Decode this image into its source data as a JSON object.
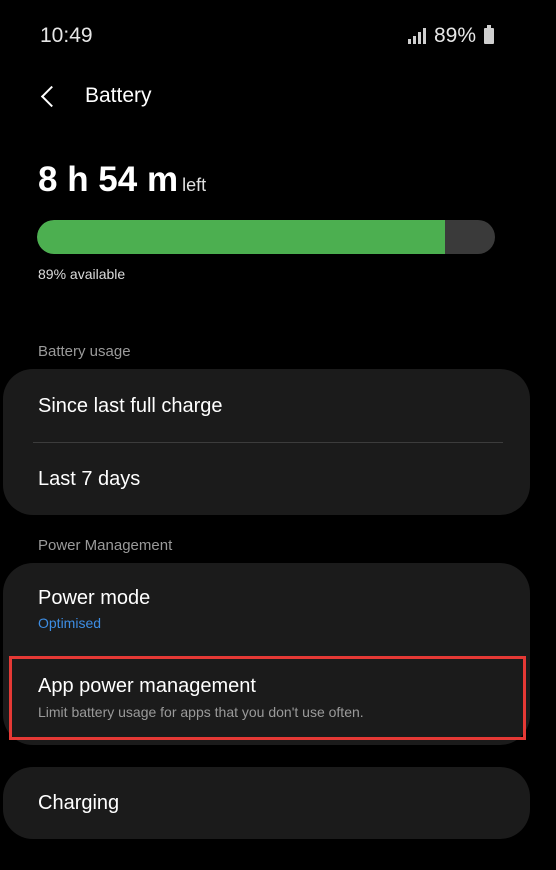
{
  "status_bar": {
    "time": "10:49",
    "battery_percent": "89%",
    "icons": [
      "signal-icon",
      "battery-icon"
    ]
  },
  "header": {
    "title": "Battery",
    "back_icon": "back-arrow-icon"
  },
  "battery": {
    "time_left": "8 h 54 m",
    "time_left_suffix": "left",
    "level_fraction": 0.89,
    "available_text": "89% available",
    "fill_color": "#4caf50"
  },
  "sections": {
    "usage_header": "Battery usage",
    "usage_items": [
      {
        "label": "Since last full charge"
      },
      {
        "label": "Last 7 days"
      }
    ],
    "power_header": "Power Management",
    "power_mode": {
      "label": "Power mode",
      "value": "Optimised",
      "value_color": "#3d8de3"
    },
    "app_power": {
      "label": "App power management",
      "description": "Limit battery usage for apps that you don't use often."
    },
    "charging": {
      "label": "Charging"
    }
  },
  "colors": {
    "background": "#000000",
    "card": "#1b1b1b",
    "highlight": "#e53935"
  }
}
